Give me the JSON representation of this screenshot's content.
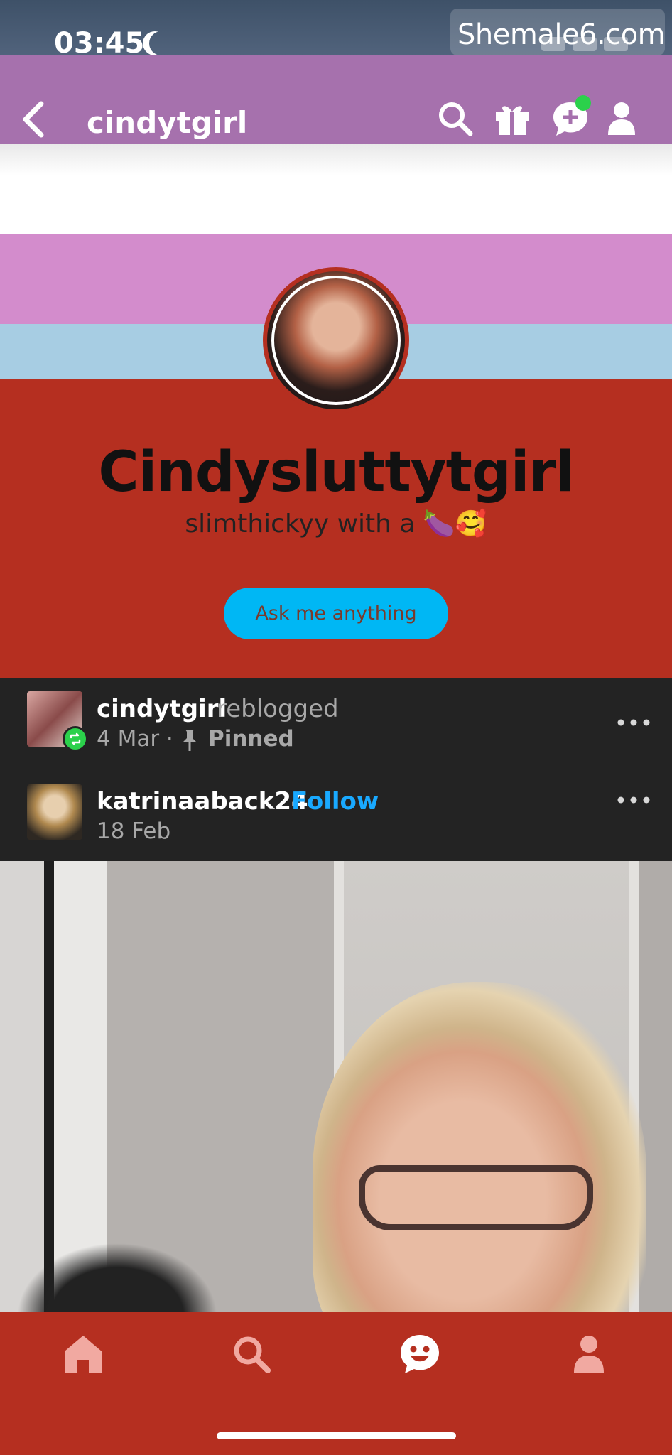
{
  "status_bar": {
    "time": "03:45"
  },
  "watermark": "Shemale6.com",
  "top_nav": {
    "blog_name": "cindytgirl"
  },
  "profile": {
    "title": "Cindysluttytgirl",
    "description": "slimthickyy with a 🍆🥰",
    "ask_button": "Ask me anything"
  },
  "posts": [
    {
      "name": "cindytgirl",
      "verb": "reblogged",
      "date": "4 Mar ·",
      "pinned": "Pinned"
    },
    {
      "name": "katrinaaback24",
      "action": "Follow",
      "date": "18 Feb"
    }
  ],
  "colors": {
    "accent_red": "#b52f20",
    "nav_purple": "#a671ad",
    "follow_blue": "#19a9ff",
    "ask_blue": "#00b7f4",
    "badge_green": "#2bd14b"
  },
  "icons": {
    "top_nav": [
      "back-icon",
      "search-icon",
      "gift-icon",
      "new-message-icon",
      "account-icon"
    ],
    "bottom_tabs": [
      "home-icon",
      "search-icon",
      "activity-icon",
      "account-icon"
    ]
  }
}
